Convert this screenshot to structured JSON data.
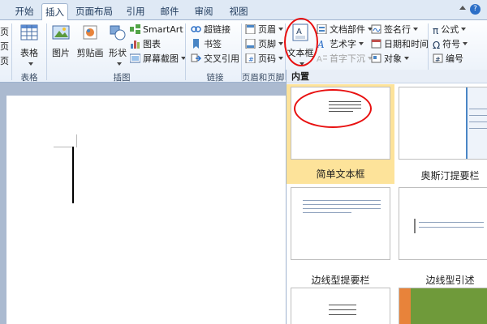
{
  "tabs": [
    "开始",
    "插入",
    "页面布局",
    "引用",
    "邮件",
    "审阅",
    "视图"
  ],
  "active_tab": "插入",
  "ribbon": {
    "left_partial": [
      "页",
      "页",
      "页"
    ],
    "table_group": {
      "button": "表格",
      "label": "表格"
    },
    "illustration_group": {
      "picture": "图片",
      "clipart": "剪贴画",
      "shapes": "形状",
      "smartart": "SmartArt",
      "chart": "图表",
      "screenshot": "屏幕截图",
      "label": "插图"
    },
    "links_group": {
      "hyperlink": "超链接",
      "bookmark": "书签",
      "crossref": "交叉引用",
      "label": "链接"
    },
    "header_footer_group": {
      "header": "页眉",
      "footer": "页脚",
      "page_number": "页码",
      "label": "页眉和页脚"
    },
    "text_group": {
      "textbox": "文本框",
      "quickparts": "文档部件",
      "wordart": "艺术字",
      "dropcap": "首字下沉",
      "signature": "签名行",
      "datetime": "日期和时间",
      "object": "对象"
    },
    "symbols_group": {
      "equation": "公式",
      "symbol": "符号",
      "number": "编号"
    }
  },
  "gallery": {
    "header": "内置",
    "items": [
      {
        "label": "简单文本框",
        "selected": true
      },
      {
        "label": "奥斯汀提要栏",
        "selected": false
      },
      {
        "label": "边线型提要栏",
        "selected": false
      },
      {
        "label": "边线型引述",
        "selected": false
      }
    ]
  },
  "colors": {
    "accent_red": "#e81010",
    "selection": "#fde39a",
    "ribbon_tab_text": "#1e395b"
  }
}
